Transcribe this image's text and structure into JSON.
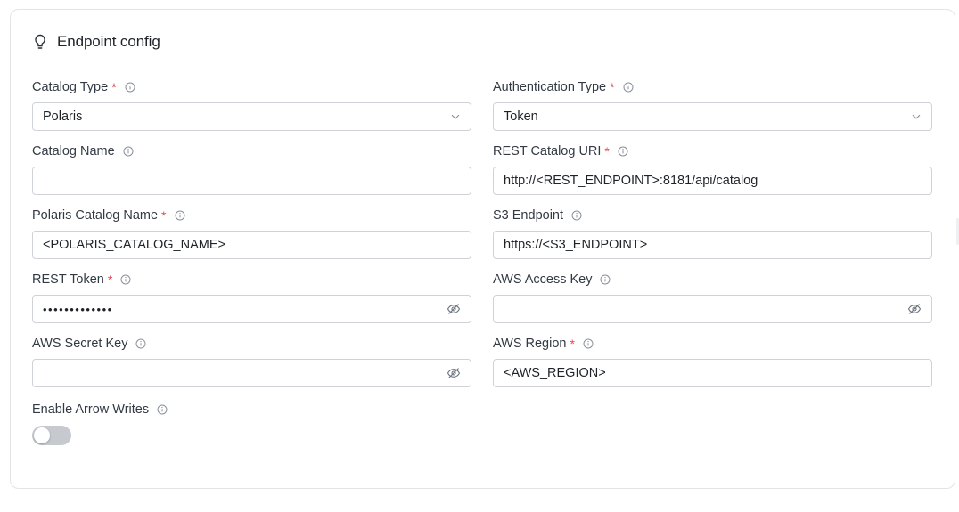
{
  "header": {
    "title": "Endpoint config",
    "icon": "lightbulb-icon"
  },
  "fields": {
    "catalog_type": {
      "label": "Catalog Type",
      "required": "*",
      "value": "Polaris"
    },
    "auth_type": {
      "label": "Authentication Type",
      "required": "*",
      "value": "Token"
    },
    "catalog_name": {
      "label": "Catalog Name",
      "value": "",
      "placeholder": ""
    },
    "rest_catalog_uri": {
      "label": "REST Catalog URI",
      "required": "*",
      "value": "http://<REST_ENDPOINT>:8181/api/catalog"
    },
    "polaris_catalog_name": {
      "label": "Polaris Catalog Name",
      "required": "*",
      "value": "<POLARIS_CATALOG_NAME>"
    },
    "s3_endpoint": {
      "label": "S3 Endpoint",
      "value": "https://<S3_ENDPOINT>"
    },
    "rest_token": {
      "label": "REST Token",
      "required": "*",
      "value": "•••••••••••••"
    },
    "aws_access_key": {
      "label": "AWS Access Key",
      "value": ""
    },
    "aws_secret_key": {
      "label": "AWS Secret Key",
      "value": ""
    },
    "aws_region": {
      "label": "AWS Region",
      "required": "*",
      "value": "<AWS_REGION>"
    },
    "enable_arrow_writes": {
      "label": "Enable Arrow Writes",
      "enabled": false
    }
  },
  "colors": {
    "required": "#e5484d",
    "border": "#cfd3d8",
    "toggle_off": "#c6c9ce"
  }
}
